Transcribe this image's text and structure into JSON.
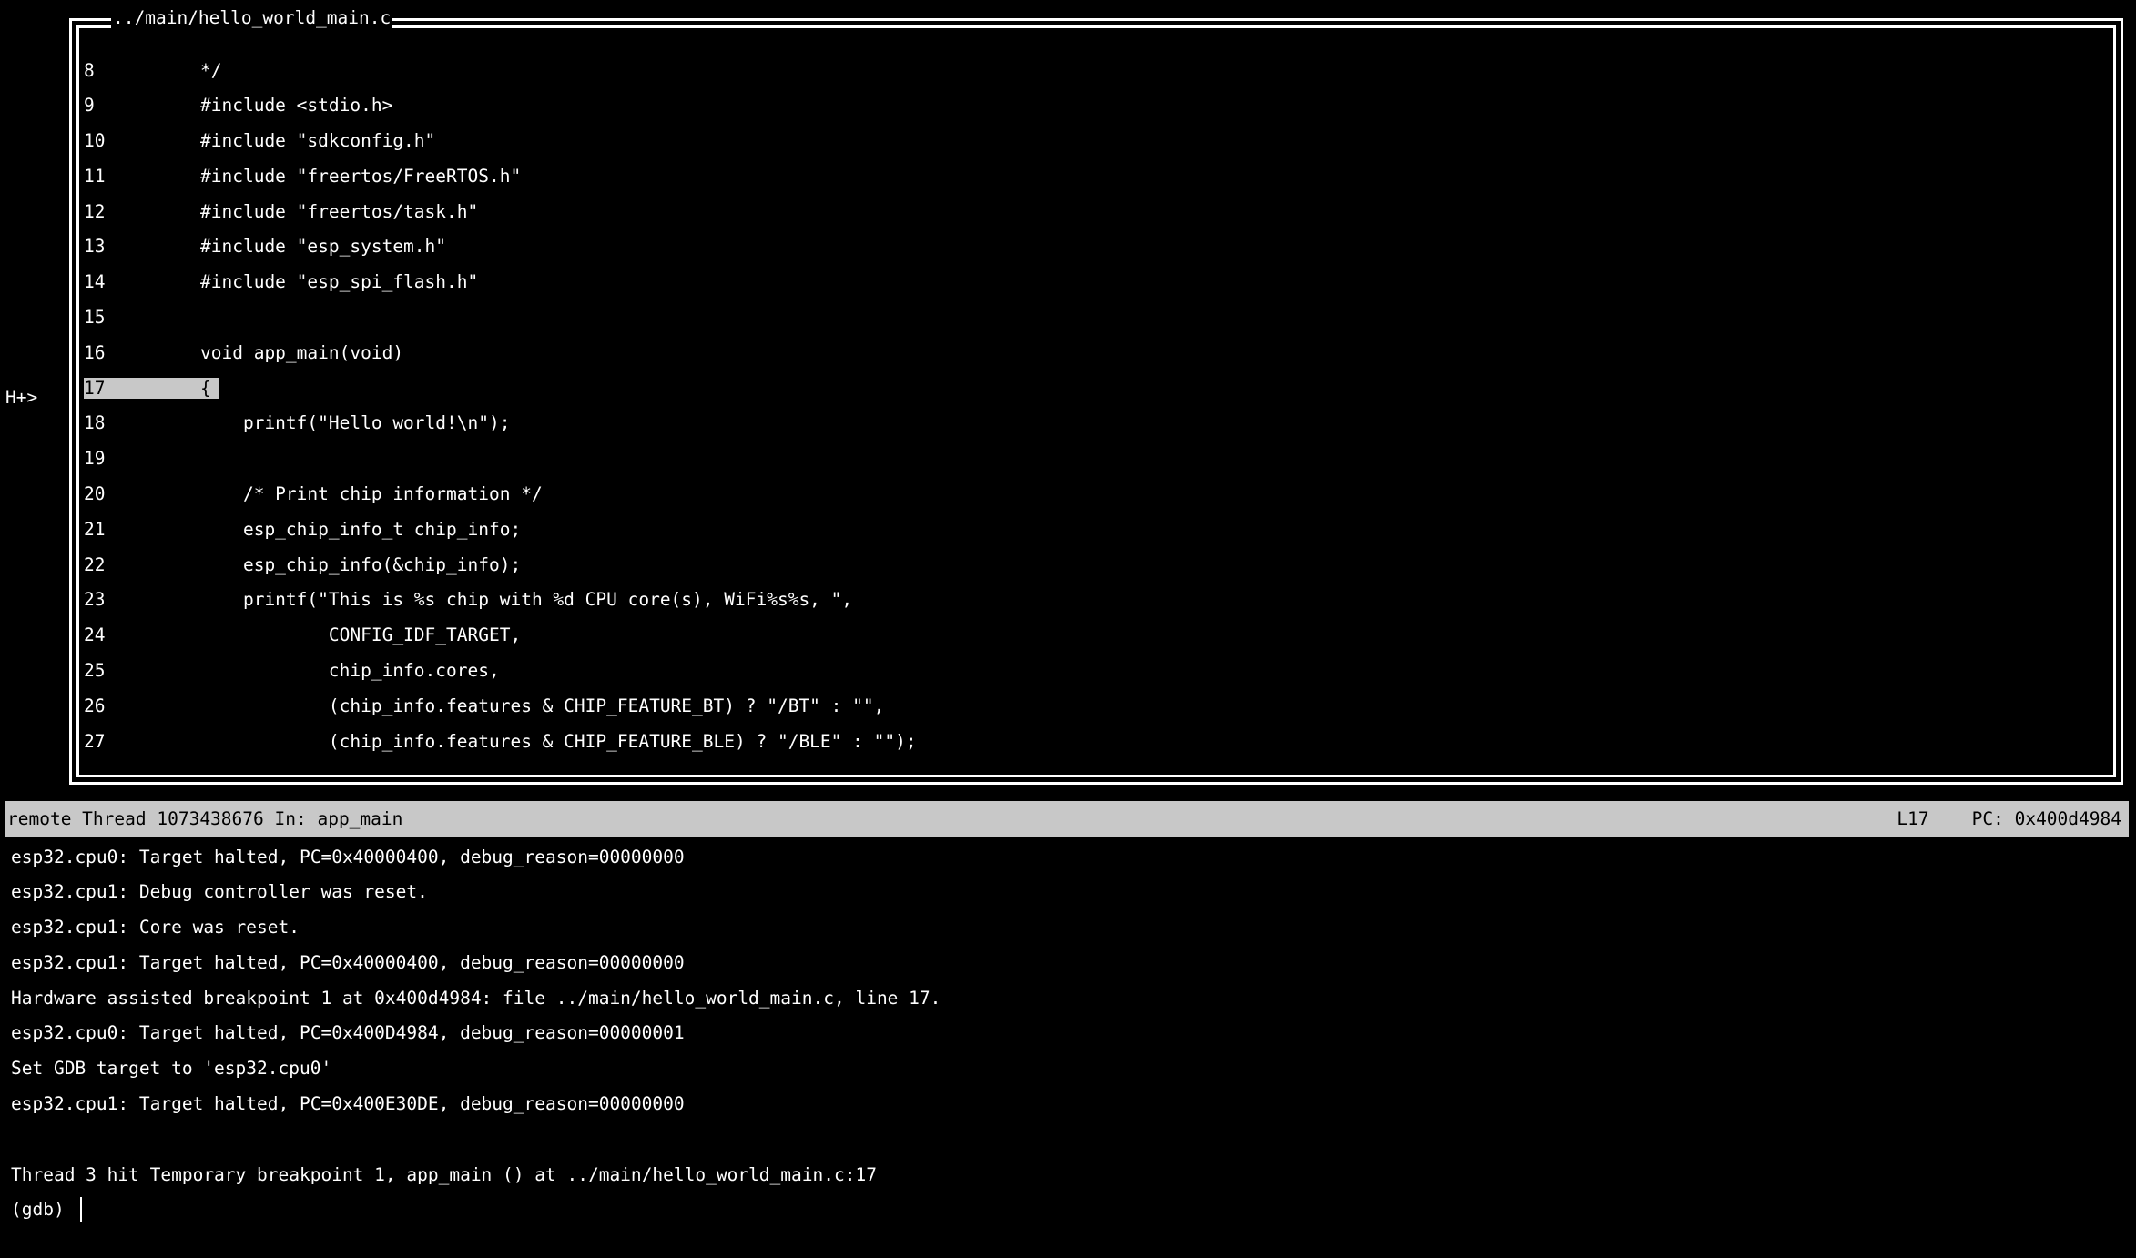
{
  "marker": "H+>",
  "title": "../main/hello_world_main.c",
  "highlighted_line_number": 17,
  "source_lines": [
    {
      "n": 8,
      "text": "*/"
    },
    {
      "n": 9,
      "text": "#include <stdio.h>"
    },
    {
      "n": 10,
      "text": "#include \"sdkconfig.h\""
    },
    {
      "n": 11,
      "text": "#include \"freertos/FreeRTOS.h\""
    },
    {
      "n": 12,
      "text": "#include \"freertos/task.h\""
    },
    {
      "n": 13,
      "text": "#include \"esp_system.h\""
    },
    {
      "n": 14,
      "text": "#include \"esp_spi_flash.h\""
    },
    {
      "n": 15,
      "text": ""
    },
    {
      "n": 16,
      "text": "void app_main(void)"
    },
    {
      "n": 17,
      "text": "{"
    },
    {
      "n": 18,
      "text": "    printf(\"Hello world!\\n\");"
    },
    {
      "n": 19,
      "text": ""
    },
    {
      "n": 20,
      "text": "    /* Print chip information */"
    },
    {
      "n": 21,
      "text": "    esp_chip_info_t chip_info;"
    },
    {
      "n": 22,
      "text": "    esp_chip_info(&chip_info);"
    },
    {
      "n": 23,
      "text": "    printf(\"This is %s chip with %d CPU core(s), WiFi%s%s, \","
    },
    {
      "n": 24,
      "text": "            CONFIG_IDF_TARGET,"
    },
    {
      "n": 25,
      "text": "            chip_info.cores,"
    },
    {
      "n": 26,
      "text": "            (chip_info.features & CHIP_FEATURE_BT) ? \"/BT\" : \"\","
    },
    {
      "n": 27,
      "text": "            (chip_info.features & CHIP_FEATURE_BLE) ? \"/BLE\" : \"\");"
    }
  ],
  "status": {
    "left": "remote Thread 1073438676 In: app_main",
    "line_label": "L17",
    "pc_label": "PC: 0x400d4984"
  },
  "console_lines": [
    "esp32.cpu0: Target halted, PC=0x40000400, debug_reason=00000000",
    "esp32.cpu1: Debug controller was reset.",
    "esp32.cpu1: Core was reset.",
    "esp32.cpu1: Target halted, PC=0x40000400, debug_reason=00000000",
    "Hardware assisted breakpoint 1 at 0x400d4984: file ../main/hello_world_main.c, line 17.",
    "esp32.cpu0: Target halted, PC=0x400D4984, debug_reason=00000001",
    "Set GDB target to 'esp32.cpu0'",
    "esp32.cpu1: Target halted, PC=0x400E30DE, debug_reason=00000000",
    "",
    "Thread 3 hit Temporary breakpoint 1, app_main () at ../main/hello_world_main.c:17"
  ],
  "prompt": "(gdb) "
}
